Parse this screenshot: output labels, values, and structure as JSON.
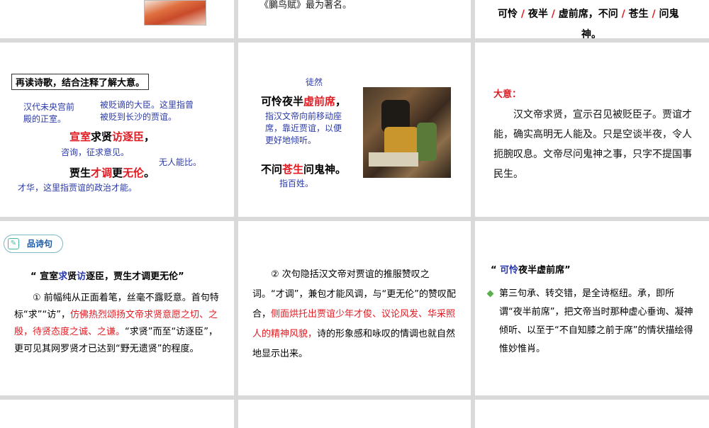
{
  "slide1": {
    "text": "《鵩鸟赋》最为著名。"
  },
  "slide2": {
    "line1": [
      {
        "t": "可怜",
        "c": "k"
      },
      {
        "t": " / ",
        "c": "r"
      },
      {
        "t": "夜半",
        "c": "k"
      },
      {
        "t": " / ",
        "c": "r"
      },
      {
        "t": "虚前席，不问",
        "c": "k"
      },
      {
        "t": " / ",
        "c": "r"
      },
      {
        "t": "苍生",
        "c": "k"
      },
      {
        "t": " / ",
        "c": "r"
      },
      {
        "t": "问鬼",
        "c": "k"
      }
    ],
    "line2": "神。"
  },
  "slide3": {
    "title": "再读诗歌，结合注释了解大意。",
    "note1": "汉代未央宫前\n殿的正室。",
    "note2": "被贬谪的大臣。这里指曾\n被贬到长沙的贾谊。",
    "verse1": [
      {
        "t": "宣室",
        "c": "r"
      },
      {
        "t": "求贤",
        "c": "k"
      },
      {
        "t": "访逐臣",
        "c": "r"
      },
      {
        "t": "，",
        "c": "k"
      }
    ],
    "note3": "咨询，征求意见。",
    "note4": "无人能比。",
    "verse2": [
      {
        "t": "贾生",
        "c": "k"
      },
      {
        "t": "才调",
        "c": "r"
      },
      {
        "t": "更",
        "c": "k"
      },
      {
        "t": "无伦",
        "c": "r"
      },
      {
        "t": "。",
        "c": "k"
      }
    ],
    "note5": "才华，这里指贾谊的政治才能。"
  },
  "slide4": {
    "note1": "徒然",
    "verse1": [
      {
        "t": "可怜夜半",
        "c": "k"
      },
      {
        "t": "虚前席",
        "c": "r"
      },
      {
        "t": "，",
        "c": "k"
      }
    ],
    "note2": "指汉文帝向前移动座\n席，靠近贾谊，以便\n更好地倾听。",
    "verse2": [
      {
        "t": "不问",
        "c": "k"
      },
      {
        "t": "苍生",
        "c": "r"
      },
      {
        "t": "问鬼神。",
        "c": "k"
      }
    ],
    "note3": "指百姓。"
  },
  "slide5": {
    "label": "大意：",
    "body": "汉文帝求贤，宣示召见被贬臣子。贾谊才能，确实高明无人能及。只是空谈半夜，令人扼腕叹息。文帝尽问鬼神之事，只字不提国事民生。"
  },
  "slide6": {
    "tag": "品诗句",
    "title": [
      {
        "t": "“ 宣室",
        "c": "k"
      },
      {
        "t": "求",
        "c": "b"
      },
      {
        "t": "贤",
        "c": "k"
      },
      {
        "t": "访",
        "c": "b"
      },
      {
        "t": "逐臣，贾生才调更无伦”",
        "c": "k"
      }
    ],
    "body": [
      {
        "t": "① 前幅纯从正面着笔，丝毫不露贬意。首句特标“求”“访”，",
        "c": "k"
      },
      {
        "t": "仿佛热烈颂扬文帝求贤意愿之切、之殷，待贤态度之诚、之谦。",
        "c": "r"
      },
      {
        "t": "“求贤”而至“访逐臣”，更可见其网罗贤才已达到“野无遗贤”的程度。",
        "c": "k"
      }
    ]
  },
  "slide7": {
    "body": [
      {
        "t": "② 次句隐括汉文帝对贾谊的推服赞叹之词。“才调”，兼包才能风调，与“更无伦”的赞叹配合，",
        "c": "k"
      },
      {
        "t": "侧面烘托出贾谊少年才俊、议论风发、华采照人的精神风貌，",
        "c": "r"
      },
      {
        "t": "诗的形象感和咏叹的情调也就自然地显示出来。",
        "c": "k"
      }
    ]
  },
  "slide8": {
    "title": [
      {
        "t": "“ ",
        "c": "k"
      },
      {
        "t": "可怜",
        "c": "b"
      },
      {
        "t": "夜半虚前席”",
        "c": "k"
      }
    ],
    "bullet_icon": "diamond-bullet-icon",
    "body": "第三句承、转交错，是全诗枢纽。承，即所谓“夜半前席”，把文帝当时那种虚心垂询、凝神倾听、以至于“不自知膝之前于席”的情状描绘得惟妙惟肖。"
  }
}
